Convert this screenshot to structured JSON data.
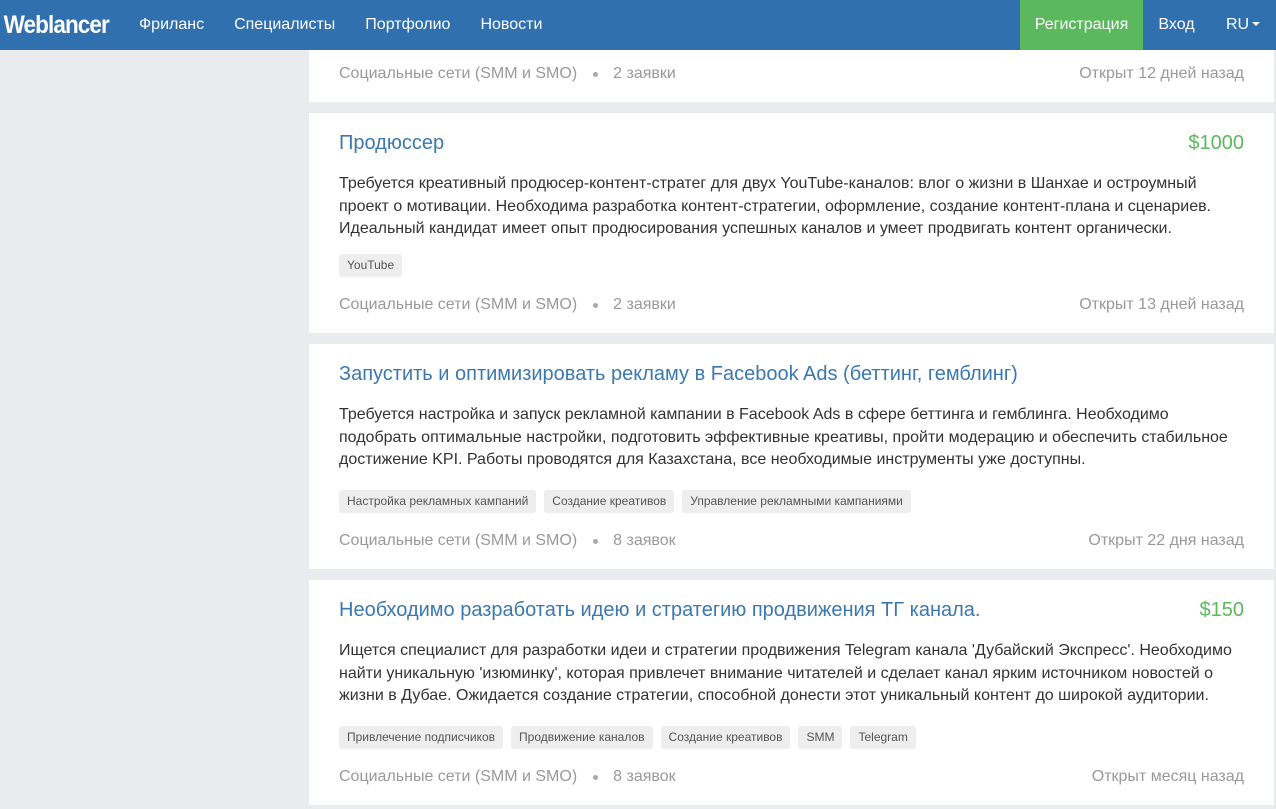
{
  "nav": {
    "logo": "Weblancer",
    "links": [
      "Фриланс",
      "Специалисты",
      "Портфолио",
      "Новости"
    ],
    "register": "Регистрация",
    "login": "Вход",
    "lang": "RU"
  },
  "jobs": [
    {
      "title": "",
      "price": "",
      "description": "",
      "tags": [],
      "category": "Социальные сети (SMM и SMO)",
      "bids": "2 заявки",
      "opened": "Открыт 12 дней назад"
    },
    {
      "title": "Продюссер",
      "price": "$1000",
      "description_lines": [
        "Требуется креативный продюсер-контент-стратег для двух YouTube-каналов: влог о жизни в Шанхае и остроумный",
        "проект о мотивации. Необходима разработка контент-стратегии, оформление, создание контент-плана и сценариев.",
        "Идеальный кандидат имеет опыт продюсирования успешных каналов и умеет продвигать контент органически."
      ],
      "tags": [
        "YouTube"
      ],
      "category": "Социальные сети (SMM и SMO)",
      "bids": "2 заявки",
      "opened": "Открыт 13 дней назад"
    },
    {
      "title": "Запустить и оптимизировать рекламу в Facebook Ads (беттинг, гемблинг)",
      "price": "",
      "description_lines": [
        "Требуется настройка и запуск рекламной кампании в Facebook Ads в сфере беттинга и гемблинга. Необходимо",
        "подобрать оптимальные настройки, подготовить эффективные креативы, пройти модерацию и обеспечить стабильное",
        "достижение KPI. Работы проводятся для Казахстана, все необходимые инструменты уже доступны."
      ],
      "tags": [
        "Настройка рекламных кампаний",
        "Создание креативов",
        "Управление рекламными кампаниями"
      ],
      "category": "Социальные сети (SMM и SMO)",
      "bids": "8 заявок",
      "opened": "Открыт 22 дня назад"
    },
    {
      "title": "Необходимо разработать идею и стратегию продвижения ТГ канала.",
      "price": "$150",
      "description_lines": [
        "Ищется специалист для разработки идеи и стратегии продвижения Telegram канала 'Дубайский Экспресс'. Необходимо",
        "найти уникальную 'изюминку', которая привлечет внимание читателей и сделает канал ярким источником новостей о",
        "жизни в Дубае. Ожидается создание стратегии, способной донести этот уникальный контент до широкой аудитории."
      ],
      "tags": [
        "Привлечение подписчиков",
        "Продвижение каналов",
        "Создание креативов",
        "SMM",
        "Telegram"
      ],
      "category": "Социальные сети (SMM и SMO)",
      "bids": "8 заявок",
      "opened": "Открыт месяц назад"
    }
  ]
}
